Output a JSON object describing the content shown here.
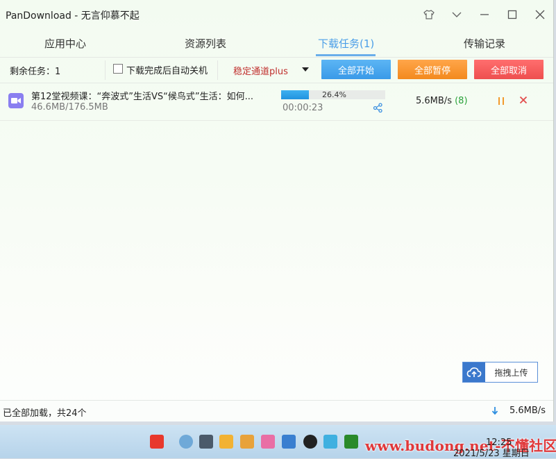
{
  "window": {
    "title": "PanDownload - 无言仰慕不起"
  },
  "tabs": [
    {
      "label": "应用中心"
    },
    {
      "label": "资源列表"
    },
    {
      "label": "下载任务(1)",
      "active": true
    },
    {
      "label": "传输记录"
    }
  ],
  "toolbar": {
    "remaining": "剩余任务：1",
    "shutdown_label": "下载完成后自动关机",
    "shutdown_checked": false,
    "channel_selected": "稳定通道plus",
    "start_all": "全部开始",
    "pause_all": "全部暂停",
    "cancel_all": "全部取消"
  },
  "task": {
    "name": "第12堂视频课：“奔波式”生活VS“候鸟式”生活：如何...",
    "size": "46.6MB/176.5MB",
    "progress_text": "26.4%",
    "progress_fraction": 0.264,
    "elapsed": "00:00:23",
    "speed": "5.6MB/s",
    "connections": "(8)",
    "icon": "video-file-icon"
  },
  "upload": {
    "label": "拖拽上传"
  },
  "status": {
    "text": "已全部加载，共24个",
    "total_speed": "5.6MB/s"
  },
  "taskbar": {
    "time": "12:25",
    "date": "2021/5/23 星期日",
    "watermark": "www.budong.net-不懂社区"
  },
  "colors": {
    "accent": "#4a9ee8",
    "start": "#3a9ae8",
    "pause": "#f38a1e",
    "cancel": "#ee4f4f",
    "channel": "#c0302e",
    "progress": "#2193e0"
  }
}
